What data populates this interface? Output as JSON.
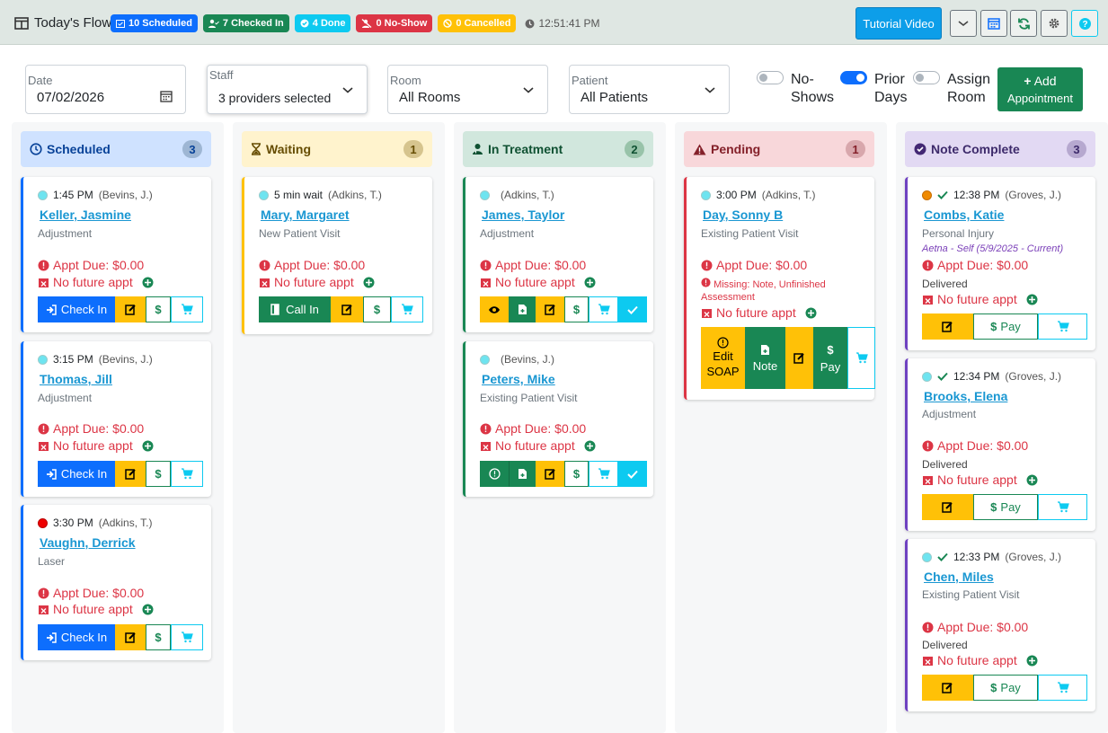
{
  "header": {
    "title": "Today's Flow",
    "badges": {
      "scheduled": "10 Scheduled",
      "checked_in": "7 Checked In",
      "done": "4 Done",
      "no_show": "0 No-Show",
      "cancelled": "0 Cancelled"
    },
    "time": "12:51:41 PM",
    "tutorial_label": "Tutorial Video",
    "icons": [
      "chevron-down-icon",
      "calendar-icon",
      "refresh-icon",
      "gear-icon",
      "help-icon"
    ]
  },
  "filters": {
    "date": {
      "label": "Date",
      "value": "07/02/2026"
    },
    "staff": {
      "label": "Staff",
      "value": "3 providers selected"
    },
    "room": {
      "label": "Room",
      "value": "All Rooms"
    },
    "patient": {
      "label": "Patient",
      "value": "All Patients"
    }
  },
  "toggles": {
    "no_shows": {
      "line1": "No-",
      "line2": "Shows",
      "on": false
    },
    "prior_days": {
      "line1": "Prior",
      "line2": "Days",
      "on": true
    },
    "assign_room": {
      "line1": "Assign",
      "line2": "Room",
      "on": false
    }
  },
  "add_button": {
    "line1": "Add",
    "line2": "Appointment"
  },
  "columns": {
    "scheduled": {
      "title": "Scheduled",
      "count": "3",
      "color": "#cfe2ff"
    },
    "waiting": {
      "title": "Waiting",
      "count": "1",
      "color": "#fff3cd"
    },
    "treatment": {
      "title": "In Treatment",
      "count": "2",
      "color": "#d1e7dd"
    },
    "pending": {
      "title": "Pending",
      "count": "1",
      "color": "#f8d7da"
    },
    "complete": {
      "title": "Note Complete",
      "count": "3",
      "color": "#e2d9f3"
    }
  },
  "common": {
    "appt_due": "Appt Due: $0.00",
    "no_future": "No future appt",
    "check_in": "Check In",
    "call_in": "Call In",
    "pay": "Pay",
    "delivered": "Delivered",
    "edit_soap_1": "Edit",
    "edit_soap_2": "SOAP",
    "note": "Note"
  },
  "cards": {
    "s1": {
      "time": "1:45 PM",
      "provider": "(Bevins, J.)",
      "name": "Keller, Jasmine",
      "type": "Adjustment"
    },
    "s2": {
      "time": "3:15 PM",
      "provider": "(Bevins, J.)",
      "name": "Thomas, Jill",
      "type": "Adjustment"
    },
    "s3": {
      "time": "3:30 PM",
      "provider": "(Adkins, T.)",
      "name": "Vaughn, Derrick",
      "type": "Laser"
    },
    "w1": {
      "time": "5 min wait",
      "provider": "(Adkins, T.)",
      "name": "Mary, Margaret",
      "type": "New Patient Visit"
    },
    "t1": {
      "time": "",
      "provider": "(Adkins, T.)",
      "name": "James, Taylor",
      "type": "Adjustment"
    },
    "t2": {
      "time": "",
      "provider": "(Bevins, J.)",
      "name": "Peters, Mike",
      "type": "Existing Patient Visit"
    },
    "p1": {
      "time": "3:00 PM",
      "provider": "(Adkins, T.)",
      "name": "Day, Sonny B",
      "type": "Existing Patient Visit",
      "missing": "Missing: Note, Unfinished Assessment"
    },
    "c1": {
      "time": "12:38 PM",
      "provider": "(Groves, J.)",
      "name": "Combs, Katie",
      "type": "Personal Injury",
      "insurance": "Aetna - Self (5/9/2025 - Current)"
    },
    "c2": {
      "time": "12:34 PM",
      "provider": "(Groves, J.)",
      "name": "Brooks, Elena",
      "type": "Adjustment"
    },
    "c3": {
      "time": "12:33 PM",
      "provider": "(Groves, J.)",
      "name": "Chen, Miles",
      "type": "Existing Patient Visit"
    }
  }
}
